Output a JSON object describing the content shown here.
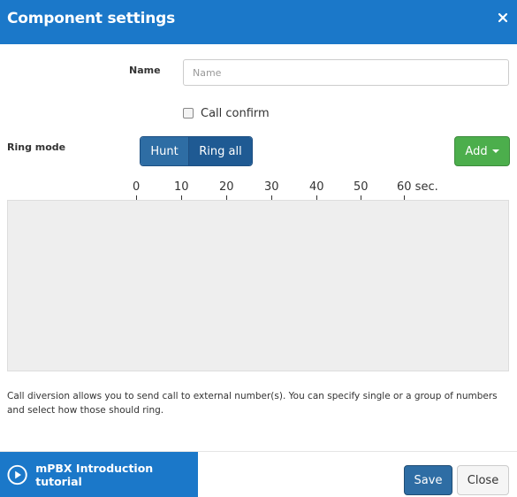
{
  "dialog": {
    "title": "Component settings",
    "close_icon": "close-icon"
  },
  "form": {
    "name_label": "Name",
    "name_placeholder": "Name",
    "name_value": "",
    "call_confirm_label": "Call confirm",
    "call_confirm_checked": false,
    "ring_mode_label": "Ring mode",
    "ring_modes": [
      "Hunt",
      "Ring all"
    ],
    "ring_mode_selected": "Ring all",
    "add_label": "Add"
  },
  "timeline": {
    "ticks": [
      "0",
      "10",
      "20",
      "30",
      "40",
      "50",
      "60 sec."
    ]
  },
  "description": "Call diversion allows you to send call to external number(s). You can specify single or a group of numbers and select how those should ring.",
  "footer": {
    "tutorial_label": "mPBX Introduction tutorial",
    "tutorial_icon": "play-circle-icon",
    "save_label": "Save",
    "close_label": "Close"
  },
  "colors": {
    "header": "#1b78c9",
    "primary": "#2e6da4",
    "success": "#4cae4c"
  }
}
